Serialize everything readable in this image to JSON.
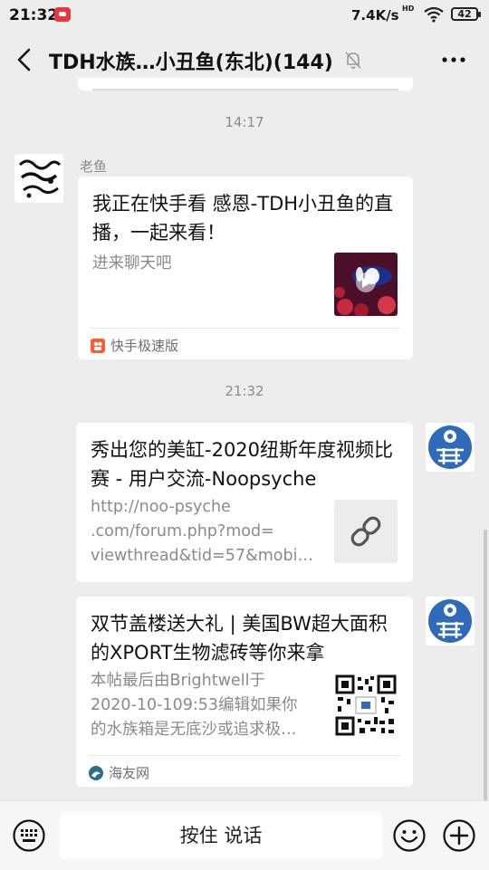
{
  "status_bar": {
    "time": "21:32",
    "network_speed": "7.4K/s",
    "hd_label": "HD",
    "battery": "42"
  },
  "header": {
    "title": "TDH水族…小丑鱼(东北)(144)"
  },
  "messages": [
    {
      "timestamp": "14:17",
      "sender": "老鱼",
      "card": {
        "title": "我正在快手看 感恩-TDH小丑鱼的直播，一起来看！",
        "description": "进来聊天吧",
        "source": "快手极速版",
        "thumbnail": "clownfish-video-thumbnail"
      }
    },
    {
      "timestamp": "21:32",
      "card": {
        "title": "秀出您的美缸-2020纽斯年度视频比赛 - 用户交流-Noopsyche",
        "description": "http://noo-psyche\n.com/forum.php?mod=\nviewthread&tid=57&mobi…",
        "thumbnail": "link-icon"
      }
    },
    {
      "card": {
        "title": "双节盖楼送大礼 | 美国BW超大面积的XPORT生物滤砖等你来拿",
        "description": "本帖最后由Brightwell于\n2020-10-109:53编辑如果你\n的水族箱是无底沙或追求极…",
        "source": "海友网",
        "thumbnail": "qr-code"
      }
    }
  ],
  "input_bar": {
    "hold_to_talk": "按住 说话"
  },
  "colors": {
    "background": "#ededed",
    "bubble": "#ffffff",
    "muted_text": "#8a8a8a"
  }
}
